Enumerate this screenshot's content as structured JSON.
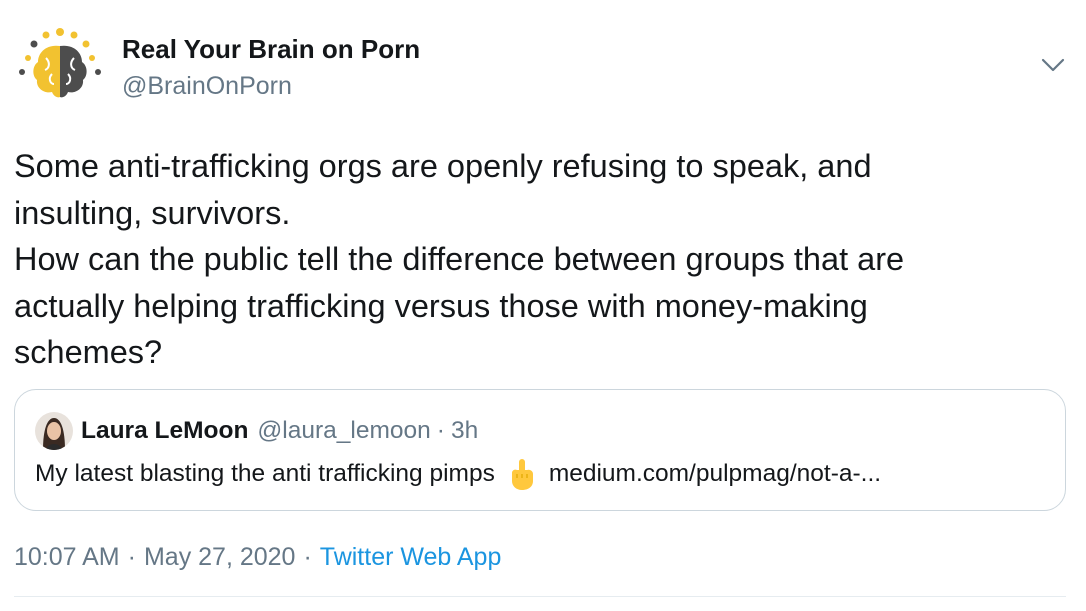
{
  "author": {
    "display_name": "Real Your Brain on Porn",
    "handle": "@BrainOnPorn"
  },
  "tweet": {
    "lines": [
      "Some anti-trafficking orgs are openly refusing to speak, and",
      "insulting, survivors.",
      "How can the public tell the difference between groups that are",
      "actually helping trafficking versus those with money-making",
      "schemes?"
    ]
  },
  "quote": {
    "display_name": "Laura LeMoon",
    "handle": "@laura_lemoon",
    "separator": "·",
    "time": "3h",
    "text": "My latest blasting the anti trafficking pimps",
    "emoji": "middle-finger-emoji",
    "link": "medium.com/pulpmag/not-a-..."
  },
  "meta": {
    "time": "10:07 AM",
    "separator": "·",
    "date": "May 27, 2020",
    "source": "Twitter Web App"
  },
  "icons": {
    "avatar": "brain-avatar-icon",
    "menu": "chevron-down-icon"
  },
  "colors": {
    "text": "#14171a",
    "secondary": "#657786",
    "link": "#1b95e0",
    "border": "#ccd6dd",
    "brain_left": "#f2c230",
    "brain_right": "#4d4d4d"
  }
}
